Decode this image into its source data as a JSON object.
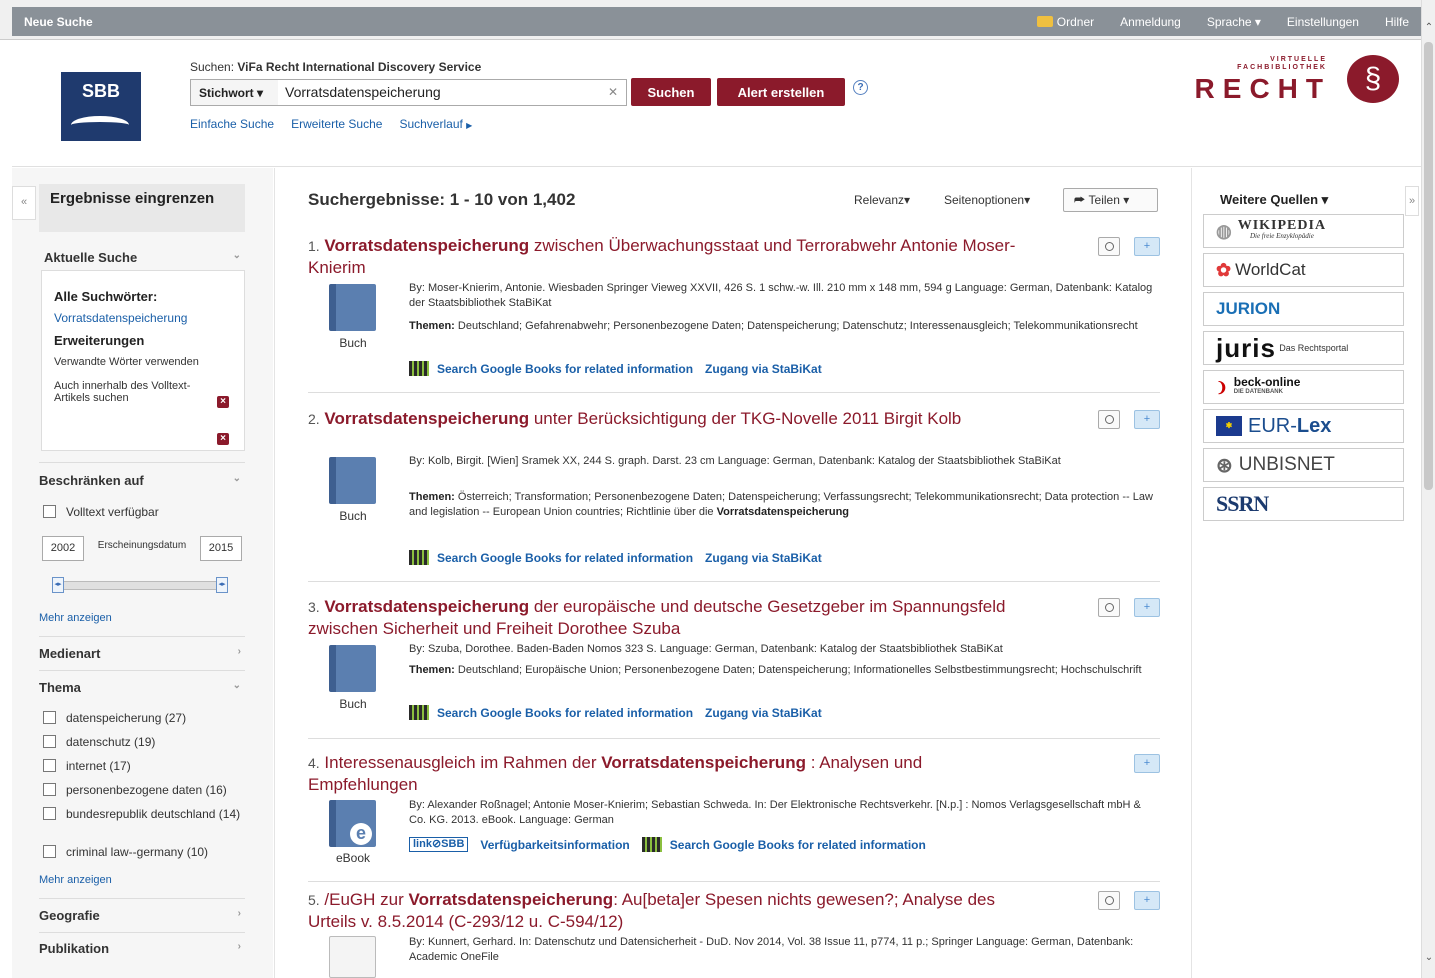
{
  "topbar": {
    "brand": "Neue Suche",
    "nav": [
      "Ordner",
      "Anmeldung",
      "Sprache",
      "Einstellungen",
      "Hilfe"
    ]
  },
  "header": {
    "logo": "SBB",
    "search_prefix": "Suchen:",
    "search_source": "ViFa Recht International Discovery Service",
    "field": "Stichwort",
    "query": "Vorratsdatenspeicherung",
    "search_btn": "Suchen",
    "alert_btn": "Alert erstellen",
    "links": [
      "Einfache Suche",
      "Erweiterte Suche",
      "Suchverlauf"
    ],
    "recht_small1": "VIRTUELLE",
    "recht_small2": "FACHBIBLIOTHEK",
    "recht_big": "RECHT",
    "recht_symbol": "§"
  },
  "left": {
    "title": "Ergebnisse eingrenzen",
    "current_search": "Aktuelle Suche",
    "all_terms": "Alle Suchwörter:",
    "term": "Vorratsdatenspeicherung",
    "extensions": "Erweiterungen",
    "ext1": "Verwandte Wörter verwenden",
    "ext2": "Auch innerhalb des Volltext-Artikels suchen",
    "limit": "Beschränken auf",
    "fulltext": "Volltext verfügbar",
    "year_from": "2002",
    "year_label": "Erscheinungsdatum",
    "year_to": "2015",
    "more1": "Mehr anzeigen",
    "media": "Medienart",
    "topic": "Thema",
    "topics": [
      "datenspeicherung (27)",
      "datenschutz (19)",
      "internet (17)",
      "personenbezogene daten (16)",
      "bundesrepublik deutschland (14)",
      "criminal law--germany (10)"
    ],
    "more2": "Mehr anzeigen",
    "geo": "Geografie",
    "pub": "Publikation"
  },
  "main": {
    "heading": "Suchergebnisse: 1 - 10 von 1,402",
    "sort": "Relevanz",
    "page_opts": "Seitenoptionen",
    "share": "Teilen",
    "results": [
      {
        "num": "1.",
        "title_bold": "Vorratsdatenspeicherung",
        "title_rest": " zwischen Überwachungsstaat und Terrorabwehr Antonie Moser-Knierim",
        "type": "Buch",
        "meta": "By: Moser-Knierim, Antonie. Wiesbaden Springer Vieweg XXVII, 426 S. 1 schw.-w. Ill. 210 mm x 148 mm, 594 g Language: German, Datenbank: Katalog der Staatsbibliothek StaBiKat",
        "themes_label": "Themen:",
        "themes": " Deutschland; Gefahrenabwehr; Personenbezogene Daten; Datenspeicherung; Datenschutz; Interessenausgleich; Telekommunikationsrecht",
        "link1": "Search Google Books for related information",
        "link2": "Zugang via StaBiKat"
      },
      {
        "num": "2.",
        "title_bold": "Vorratsdatenspeicherung",
        "title_rest": " unter Berücksichtigung der TKG-Novelle 2011 Birgit Kolb",
        "type": "Buch",
        "meta": "By: Kolb, Birgit. [Wien] Sramek XX, 244 S. graph. Darst. 23 cm Language: German, Datenbank: Katalog der Staatsbibliothek StaBiKat",
        "themes_label": "Themen:",
        "themes": " Österreich; Transformation; Personenbezogene Daten; Datenspeicherung; Verfassungsrecht; Telekommunikationsrecht; Data protection -- Law and legislation -- European Union countries; Richtlinie über die ",
        "themes_bold": "Vorratsdatenspeicherung",
        "link1": "Search Google Books for related information",
        "link2": "Zugang via StaBiKat"
      },
      {
        "num": "3.",
        "title_bold": "Vorratsdatenspeicherung",
        "title_rest": " der europäische und deutsche Gesetzgeber im Spannungsfeld zwischen Sicherheit und Freiheit Dorothee Szuba",
        "type": "Buch",
        "meta": "By: Szuba, Dorothee. Baden-Baden Nomos 323 S. Language: German, Datenbank: Katalog der Staatsbibliothek StaBiKat",
        "themes_label": "Themen:",
        "themes": " Deutschland; Europäische Union; Personenbezogene Daten; Datenspeicherung; Informationelles Selbstbestimmungsrecht; Hochschulschrift",
        "link1": "Search Google Books for related information",
        "link2": "Zugang via StaBiKat"
      },
      {
        "num": "4.",
        "title_pre": " Interessenausgleich im Rahmen der ",
        "title_bold": "Vorratsdatenspeicherung",
        "title_rest": " : Analysen und Empfehlungen",
        "type": "eBook",
        "meta": "By: Alexander Roßnagel; Antonie Moser-Knierim; Sebastian Schweda. In: Der Elektronische Rechtsverkehr. [N.p.] : Nomos Verlagsgesellschaft mbH & Co. KG. 2013. eBook. Language: German",
        "linkbox": "link⊘SBB",
        "link0": "Verfügbarkeitsinformation",
        "link1": "Search Google Books for related information"
      },
      {
        "num": "5.",
        "title_pre": " /EuGH zur ",
        "title_bold": "Vorratsdatenspeicherung",
        "title_rest": ": Au[beta]er Spesen nichts gewesen?; Analyse des Urteils v. 8.5.2014 (C-293/12 u. C-594/12)",
        "meta": "By: Kunnert, Gerhard. In: Datenschutz und Datensicherheit - DuD. Nov 2014, Vol. 38 Issue 11, p774, 11 p.; Springer Language: German, Datenbank: Academic OneFile"
      }
    ]
  },
  "right": {
    "title": "Weitere Quellen",
    "sources": [
      "WIKIPEDIA",
      "Die freie Enzyklopädie",
      "WorldCat",
      "JURION",
      "juris",
      "Das Rechtsportal",
      "beck-online",
      "DIE DATENBANK",
      "EUR-",
      "Lex",
      "UNBISNET",
      "SSRN"
    ]
  },
  "colors": {
    "accent": "#8b1a2b",
    "link": "#1a5fa8",
    "topbar": "#8a9198"
  },
  "icons": [
    "folder-icon",
    "help-icon",
    "book-icon",
    "ebook-icon",
    "magnifier-icon",
    "add-folder-icon",
    "google-books-icon",
    "share-icon"
  ]
}
